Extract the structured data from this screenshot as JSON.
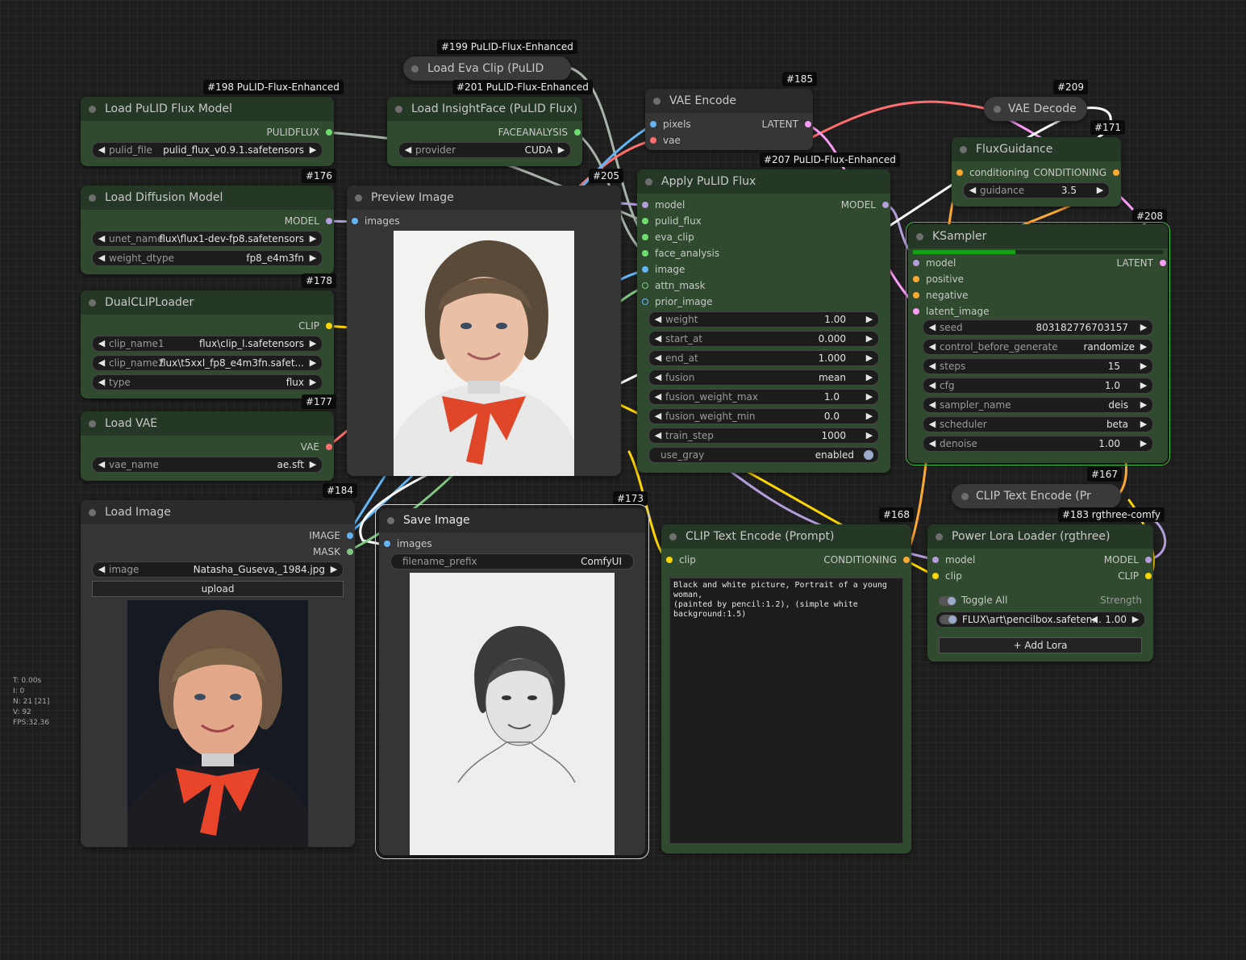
{
  "colors": {
    "canvas": "#1e1e1e",
    "node_green": "#2f4a2f",
    "node_gray": "#353535",
    "model": "#b39ddb",
    "clip": "#ffd500",
    "vae": "#ff6e6e",
    "image": "#64b5f6",
    "latent": "#ff9cf9",
    "conditioning": "#ffa931",
    "mask": "#81c784",
    "pulid": "#6fdc6f"
  },
  "nodes": {
    "load_pulid": {
      "title": "Load PuLID Flux Model",
      "badge": "#198 PuLID-Flux-Enhanced",
      "output": "PULIDFLUX",
      "pulid_file_label": "pulid_file",
      "pulid_file": "pulid_flux_v0.9.1.safetensors"
    },
    "load_eva": {
      "title": "Load Eva Clip (PuLID",
      "badge": "#199 PuLID-Flux-Enhanced"
    },
    "load_insight": {
      "title": "Load InsightFace (PuLID Flux)",
      "badge": "#201 PuLID-Flux-Enhanced",
      "output": "FACEANALYSIS",
      "provider_label": "provider",
      "provider": "CUDA"
    },
    "vae_encode": {
      "title": "VAE Encode",
      "badge": "#185",
      "in_pixels": "pixels",
      "in_vae": "vae",
      "output": "LATENT"
    },
    "vae_decode": {
      "title": "VAE Decode",
      "badge": "#209"
    },
    "flux_guidance": {
      "title": "FluxGuidance",
      "badge": "#171",
      "input": "conditioning",
      "output": "CONDITIONING",
      "guidance_label": "guidance",
      "guidance": "3.5"
    },
    "load_diffusion": {
      "title": "Load Diffusion Model",
      "badge": "#176",
      "output": "MODEL",
      "unet_label": "unet_name",
      "unet": "flux\\flux1-dev-fp8.safetensors",
      "dtype_label": "weight_dtype",
      "dtype": "fp8_e4m3fn"
    },
    "preview_image": {
      "title": "Preview Image",
      "badge": "#205",
      "input": "images"
    },
    "apply_pulid": {
      "title": "Apply PuLID Flux",
      "badge": "#207 PuLID-Flux-Enhanced",
      "output": "MODEL",
      "inputs": [
        "model",
        "pulid_flux",
        "eva_clip",
        "face_analysis",
        "image",
        "attn_mask",
        "prior_image"
      ],
      "widgets": [
        {
          "label": "weight",
          "value": "1.00"
        },
        {
          "label": "start_at",
          "value": "0.000"
        },
        {
          "label": "end_at",
          "value": "1.000"
        },
        {
          "label": "fusion",
          "value": "mean"
        },
        {
          "label": "fusion_weight_max",
          "value": "1.0"
        },
        {
          "label": "fusion_weight_min",
          "value": "0.0"
        },
        {
          "label": "train_step",
          "value": "1000"
        }
      ],
      "use_gray_label": "use_gray",
      "use_gray": "enabled"
    },
    "ksampler": {
      "title": "KSampler",
      "badge": "#208",
      "output": "LATENT",
      "inputs": [
        "model",
        "positive",
        "negative",
        "latent_image"
      ],
      "progress": 0.41,
      "widgets": [
        {
          "label": "seed",
          "value": "803182776703157"
        },
        {
          "label": "control_before_generate",
          "value": "randomize"
        },
        {
          "label": "steps",
          "value": "15"
        },
        {
          "label": "cfg",
          "value": "1.0"
        },
        {
          "label": "sampler_name",
          "value": "deis"
        },
        {
          "label": "scheduler",
          "value": "beta"
        },
        {
          "label": "denoise",
          "value": "1.00"
        }
      ]
    },
    "dual_clip": {
      "title": "DualCLIPLoader",
      "badge": "#178",
      "output": "CLIP",
      "widgets": [
        {
          "label": "clip_name1",
          "value": "flux\\clip_l.safetensors"
        },
        {
          "label": "clip_name2",
          "value": "flux\\t5xxl_fp8_e4m3fn.safet..."
        },
        {
          "label": "type",
          "value": "flux"
        }
      ]
    },
    "load_vae": {
      "title": "Load VAE",
      "badge": "#177",
      "output": "VAE",
      "vae_label": "vae_name",
      "vae": "ae.sft"
    },
    "load_image": {
      "title": "Load Image",
      "badge": "#184",
      "out_image": "IMAGE",
      "out_mask": "MASK",
      "image_label": "image",
      "image": "Natasha_Guseva,_1984.jpg",
      "upload": "upload"
    },
    "save_image": {
      "title": "Save Image",
      "badge": "#173",
      "input": "images",
      "prefix_label": "filename_prefix",
      "prefix": "ComfyUI"
    },
    "clip_text_prompt": {
      "title": "CLIP Text Encode (Prompt)",
      "badge": "#168",
      "input": "clip",
      "output": "CONDITIONING",
      "text": "Black and white picture, Portrait of a young woman,\n(painted by pencil:1.2), (simple white background:1.5)"
    },
    "clip_text_small": {
      "title": "CLIP Text Encode (Pr",
      "badge": "#167"
    },
    "power_lora": {
      "title": "Power Lora Loader (rgthree)",
      "badge": "#183 rgthree-comfy",
      "in_model": "model",
      "in_clip": "clip",
      "out_model": "MODEL",
      "out_clip": "CLIP",
      "toggle_all": "Toggle All",
      "strength_label": "Strength",
      "lora_name": "FLUX\\art\\pencilbox.safeten...",
      "lora_strength": "1.00",
      "add_lora": "Add Lora"
    }
  },
  "stats": {
    "t": "T: 0.00s",
    "i": "I: 0",
    "n": "N: 21 [21]",
    "v": "V: 92",
    "fps": "FPS:32.36"
  }
}
